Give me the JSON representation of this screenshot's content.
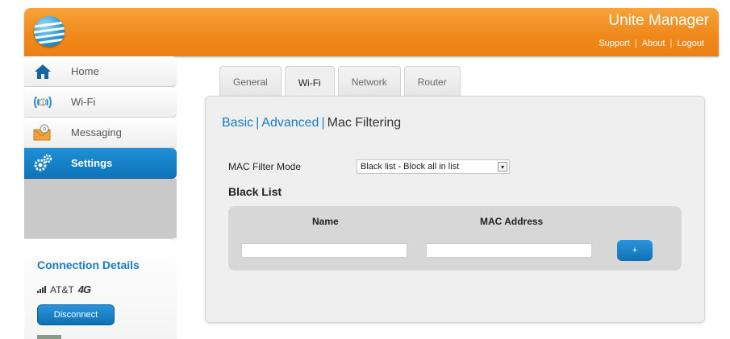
{
  "header": {
    "title": "Unite Manager",
    "links": [
      "Support",
      "About",
      "Logout"
    ],
    "brand_color": "#f08a1c"
  },
  "sidebar": {
    "items": [
      {
        "label": "Home",
        "icon": "home-icon"
      },
      {
        "label": "Wi-Fi",
        "icon": "wifi-icon"
      },
      {
        "label": "Messaging",
        "icon": "messaging-icon"
      },
      {
        "label": "Settings",
        "icon": "settings-icon",
        "active": true
      }
    ],
    "connection": {
      "title": "Connection Details",
      "carrier": "AT&T",
      "network_badge": "4G",
      "disconnect_label": "Disconnect"
    }
  },
  "tabs": [
    {
      "label": "General"
    },
    {
      "label": "Wi-Fi",
      "active": true
    },
    {
      "label": "Network"
    },
    {
      "label": "Router"
    }
  ],
  "subnav": {
    "basic": "Basic",
    "advanced": "Advanced",
    "mac_filtering": "Mac Filtering",
    "separator": "|"
  },
  "form": {
    "mode_label": "MAC Filter Mode",
    "mode_value": "Black list - Block all in list",
    "list_title": "Black List",
    "columns": [
      "Name",
      "MAC Address"
    ],
    "add_label": "+"
  },
  "colors": {
    "accent_blue": "#1a7bbf",
    "active_nav": "#1f8fd6"
  }
}
